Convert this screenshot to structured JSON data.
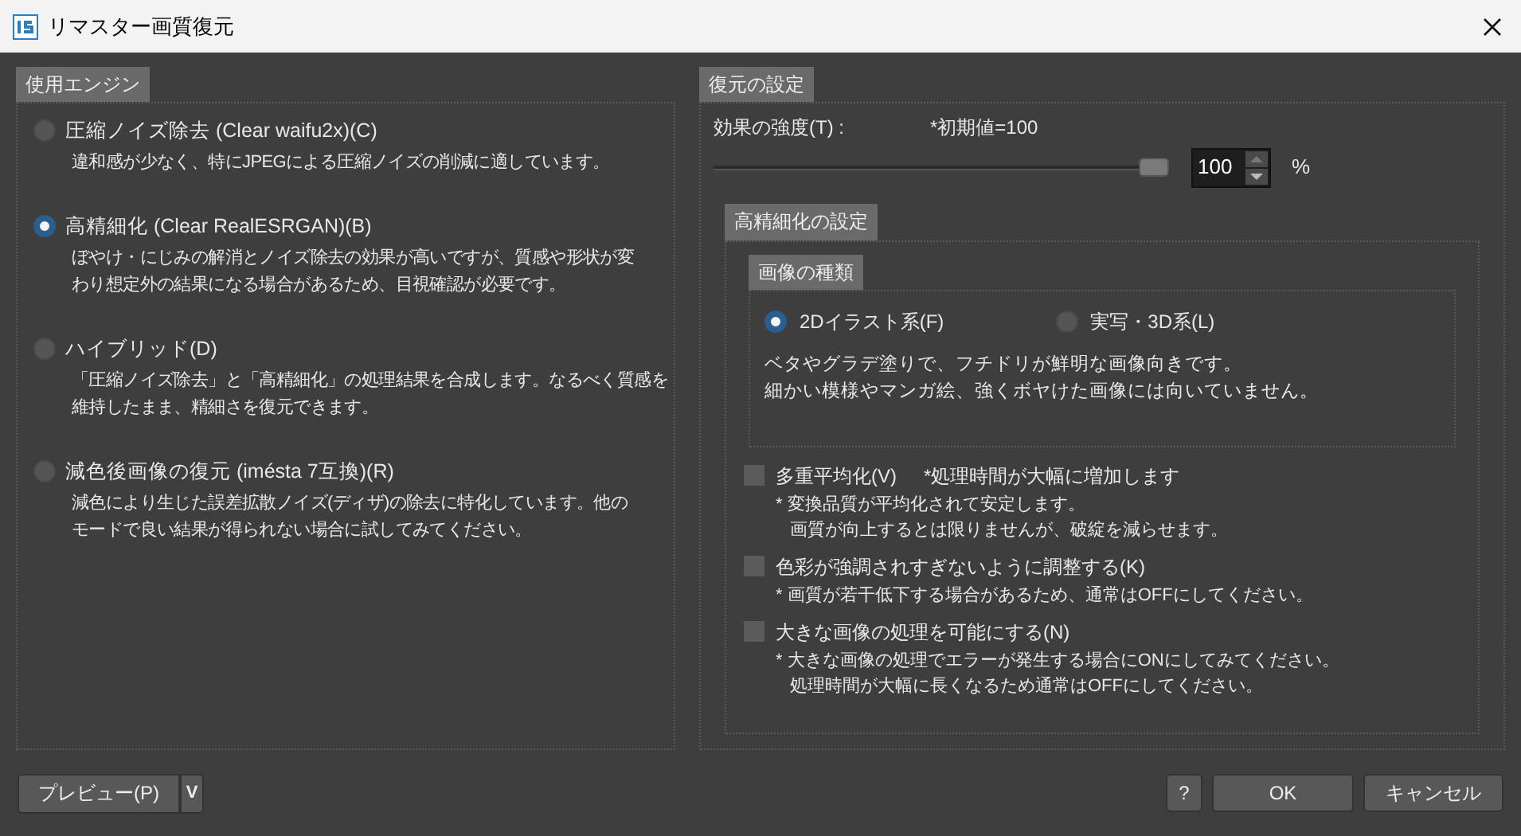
{
  "window": {
    "title": "リマスター画質復元"
  },
  "engine": {
    "title": "使用エンジン",
    "options": [
      {
        "label": "圧縮ノイズ除去 (Clear waifu2x)(C)",
        "selected": false,
        "lines": [
          "違和感が少なく、特にJPEGによる圧縮ノイズの削減に適しています。"
        ]
      },
      {
        "label": "高精細化 (Clear RealESRGAN)(B)",
        "selected": true,
        "lines": [
          "ぼやけ・にじみの解消とノイズ除去の効果が高いですが、質感や形状が変",
          "わり想定外の結果になる場合があるため、目視確認が必要です。"
        ]
      },
      {
        "label": "ハイブリッド(D)",
        "selected": false,
        "lines": [
          "「圧縮ノイズ除去」と「高精細化」の処理結果を合成します。なるべく質感を",
          "維持したまま、精細さを復元できます。"
        ]
      },
      {
        "label": "減色後画像の復元 (imésta 7互換)(R)",
        "selected": false,
        "lines": [
          "減色により生じた誤差拡散ノイズ(ディザ)の除去に特化しています。他の",
          "モードで良い結果が得られない場合に試してみてください。"
        ]
      }
    ]
  },
  "restore": {
    "title": "復元の設定",
    "strength_label": "効果の強度(T) :",
    "default_note": "*初期値=100",
    "slider": {
      "level": 1
    },
    "value": "100",
    "unit": "%",
    "detail": {
      "title": "高精細化の設定",
      "image_type": {
        "title": "画像の種類",
        "options": [
          {
            "label": "2Dイラスト系(F)",
            "selected": true
          },
          {
            "label": "実写・3D系(L)",
            "selected": false
          }
        ],
        "lines": [
          "ベタやグラデ塗りで、フチドリが鮮明な画像向きです。",
          "細かい模様やマンガ絵、強くボヤけた画像には向いていません。"
        ]
      },
      "checks": [
        {
          "label": "多重平均化(V)",
          "note": "*処理時間が大幅に増加します",
          "checked": false,
          "lines": [
            "* 変換品質が平均化されて安定します。",
            "画質が向上するとは限りませんが、破綻を減らせます。"
          ]
        },
        {
          "label": "色彩が強調されすぎないように調整する(K)",
          "checked": false,
          "lines": [
            "* 画質が若干低下する場合があるため、通常はOFFにしてください。"
          ]
        },
        {
          "label": "大きな画像の処理を可能にする(N)",
          "checked": false,
          "lines": [
            "* 大きな画像の処理でエラーが発生する場合にONにしてみてください。",
            "処理時間が大幅に長くなるため通常はOFFにしてください。"
          ]
        }
      ]
    }
  },
  "buttons": {
    "preview": "プレビュー(P)",
    "dropdown": "V",
    "help": "?",
    "ok": "OK",
    "cancel": "キャンセル"
  }
}
